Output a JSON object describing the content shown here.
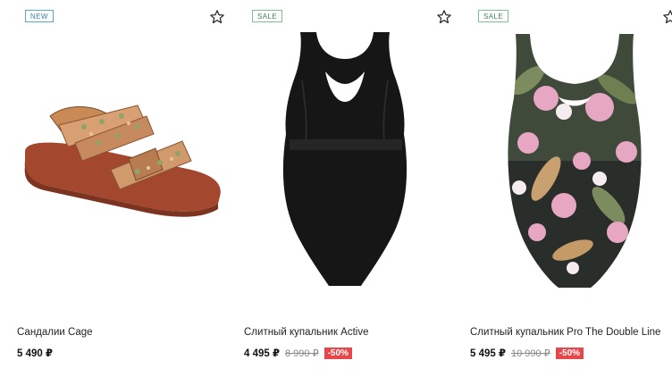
{
  "products": [
    {
      "badge": "NEW",
      "name": "Сандалии Cage",
      "price": "5 490 ₽",
      "old_price": "",
      "discount": ""
    },
    {
      "badge": "SALE",
      "name": "Слитный купальник Active",
      "price": "4 495 ₽",
      "old_price": "8 990 ₽",
      "discount": "-50%"
    },
    {
      "badge": "SALE",
      "name": "Слитный купальник Pro The Double Line",
      "price": "5 495 ₽",
      "old_price": "10 990 ₽",
      "discount": "-50%"
    }
  ],
  "icons": {
    "favorite": "star-outline-icon"
  },
  "colors": {
    "new_badge": "#5aa8c9",
    "sale_badge": "#7dc48c",
    "discount_bg": "#e5474b"
  }
}
